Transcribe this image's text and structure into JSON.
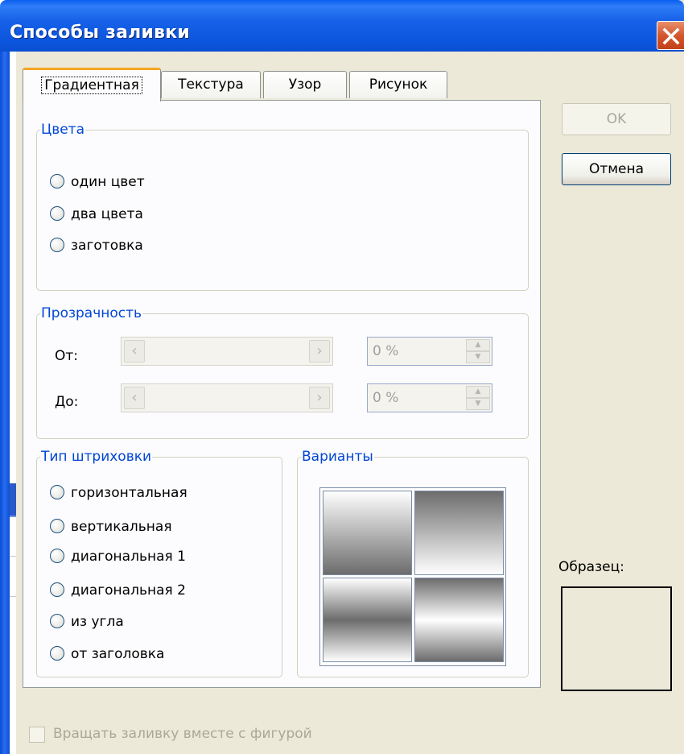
{
  "window": {
    "title": "Способы заливки",
    "close_icon": "close-icon"
  },
  "tabs": [
    {
      "label": "Градиентная",
      "active": true
    },
    {
      "label": "Текстура",
      "active": false
    },
    {
      "label": "Узор",
      "active": false
    },
    {
      "label": "Рисунок",
      "active": false
    }
  ],
  "colors_group": {
    "title": "Цвета",
    "options": [
      "один цвет",
      "два цвета",
      "заготовка"
    ]
  },
  "transparency_group": {
    "title": "Прозрачность",
    "from_label": "От:",
    "to_label": "До:",
    "from_value": "0 %",
    "to_value": "0 %"
  },
  "shading_group": {
    "title": "Тип штриховки",
    "options": [
      "горизонтальная",
      "вертикальная",
      "диагональная 1",
      "диагональная 2",
      "из угла",
      "от заголовка"
    ]
  },
  "variants_group": {
    "title": "Варианты"
  },
  "buttons": {
    "ok": "OK",
    "cancel": "Отмена"
  },
  "sample": {
    "label": "Образец:"
  },
  "rotate_checkbox": {
    "label": "Вращать заливку вместе с фигурой",
    "checked": false,
    "enabled": false
  },
  "theme_colors": {
    "title_bar": "#0a5ef0",
    "dialog_bg": "#ece9d8",
    "group_title": "#0046d5",
    "active_tab_accent": "#f5a623"
  }
}
